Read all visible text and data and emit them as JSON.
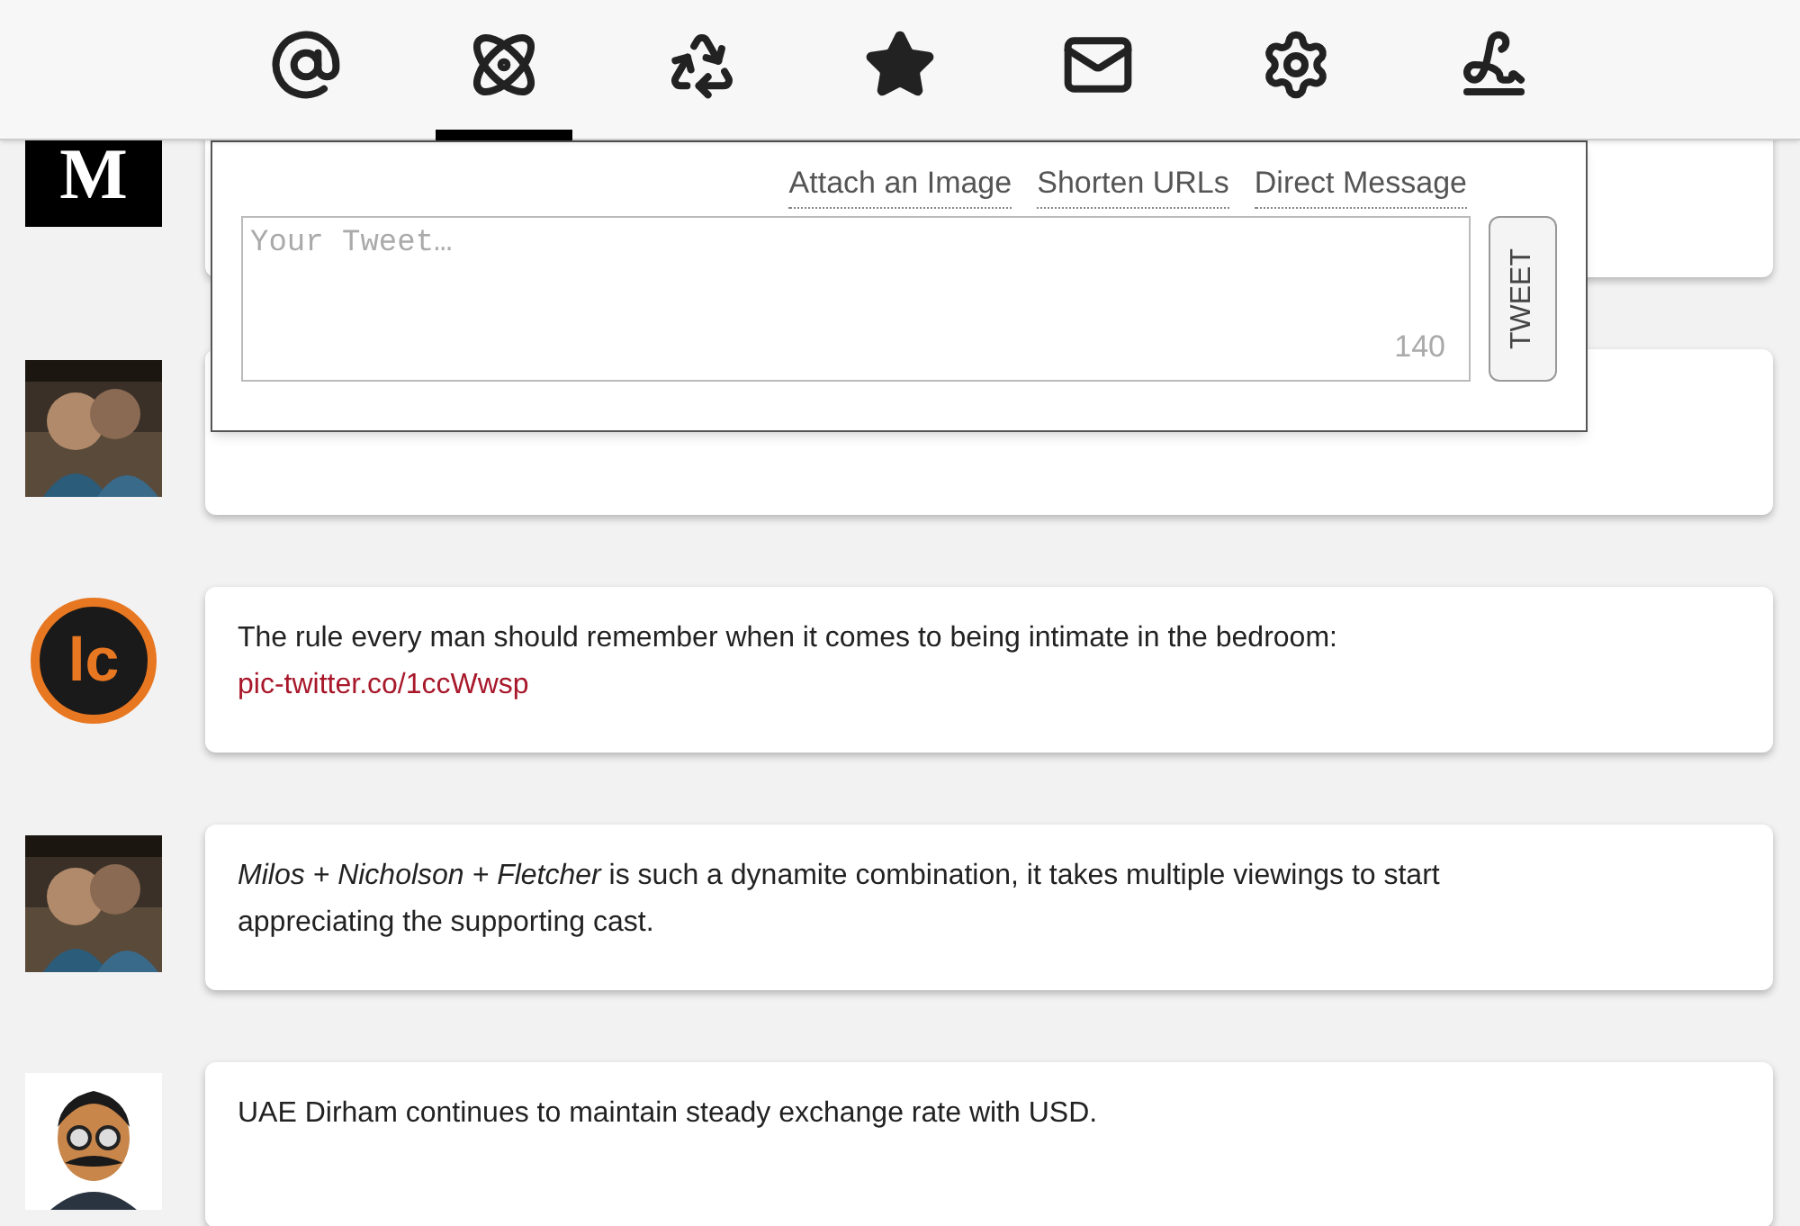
{
  "nav": [
    {
      "kind": "mentions",
      "selected": false
    },
    {
      "kind": "atom",
      "selected": true
    },
    {
      "kind": "recycle",
      "selected": false
    },
    {
      "kind": "star",
      "selected": false
    },
    {
      "kind": "mail",
      "selected": false
    },
    {
      "kind": "settings",
      "selected": false
    },
    {
      "kind": "compose",
      "selected": false
    }
  ],
  "compose": {
    "links": [
      "Attach an Image",
      "Shorten URLs",
      "Direct Message"
    ],
    "placeholder": "Your Tweet…",
    "counter": "140",
    "button": "TWEET"
  },
  "tweets": [
    {
      "avatar": {
        "kind": "letter",
        "text": "M"
      }
    },
    {
      "avatar": {
        "kind": "picture"
      }
    },
    {
      "avatar": {
        "kind": "badge",
        "text": "lc"
      },
      "text": "The rule every man should remember when it comes to being intimate in the bedroom:",
      "link": "pic-twitter.co/1ccWwsp"
    },
    {
      "avatar": {
        "kind": "picture"
      },
      "text": "*Milos + Nicholson + Fletcher* is such a dynamite combination, it takes multiple viewings to start appreciating the supporting cast."
    },
    {
      "avatar": {
        "kind": "cartoon"
      },
      "text": "UAE Dirham continues to maintain steady exchange rate with USD."
    }
  ]
}
